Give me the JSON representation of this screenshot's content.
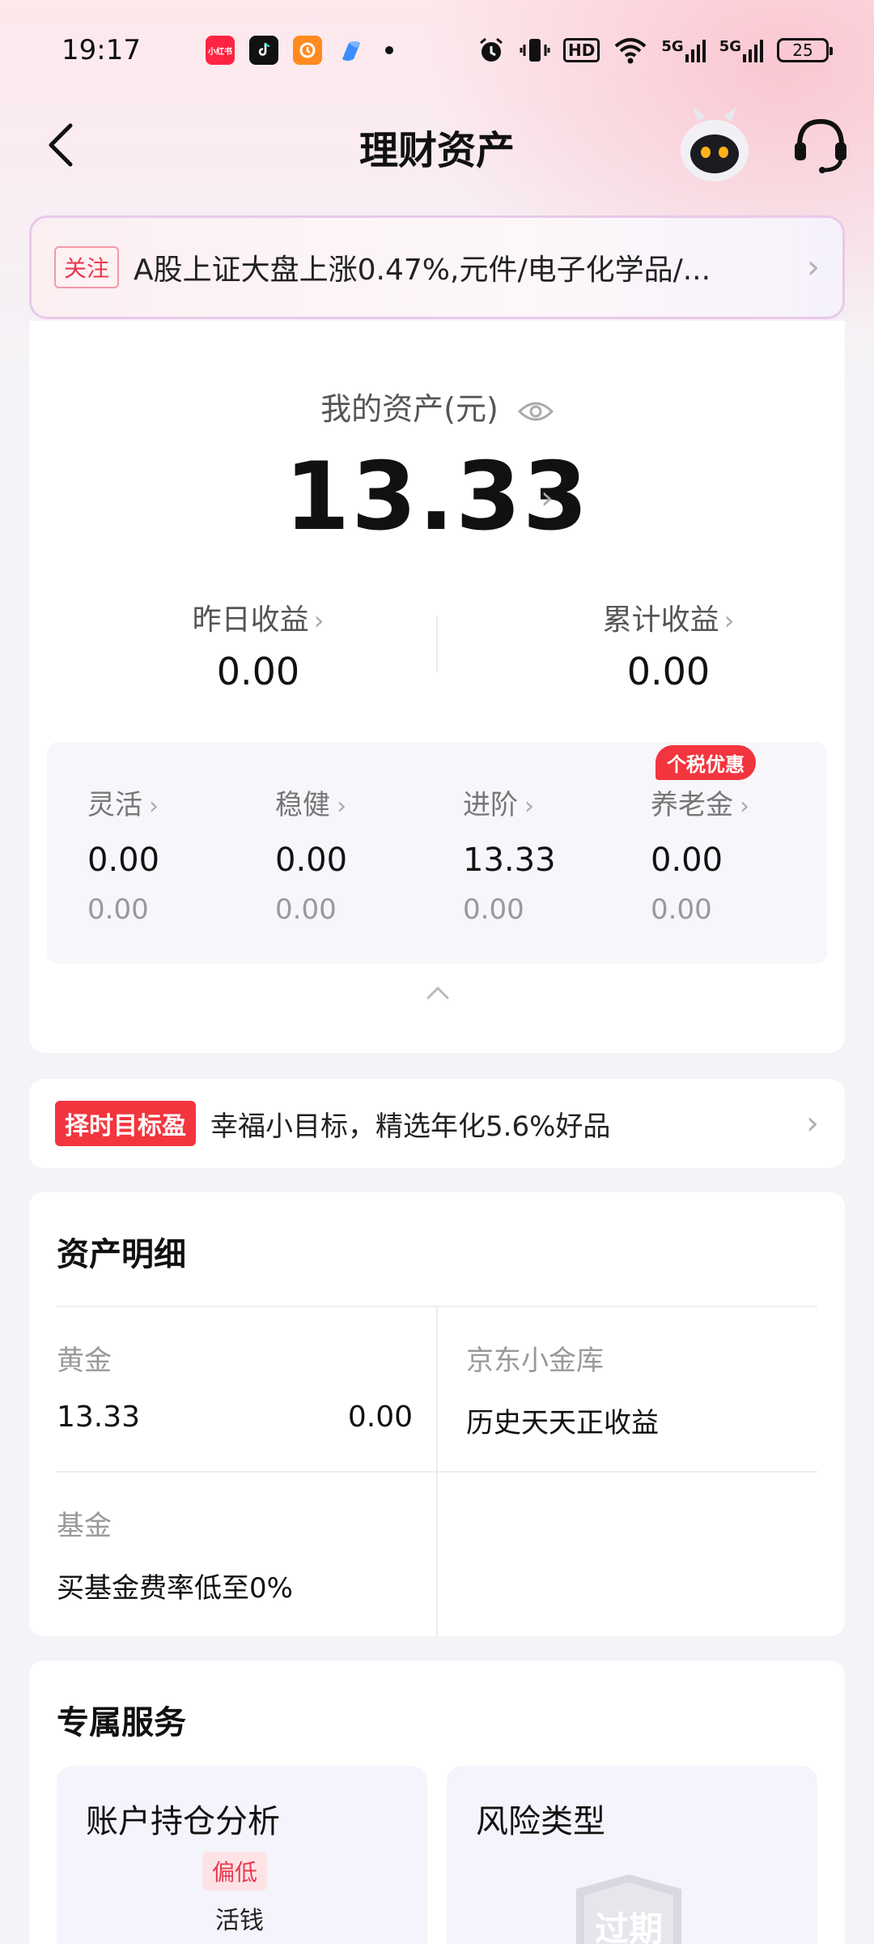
{
  "status_bar": {
    "time": "19:17",
    "app_icons": [
      "小红书",
      "抖音",
      "美团",
      "浏览器"
    ],
    "network_labels": [
      "HD",
      "5G",
      "5G"
    ],
    "battery": "25"
  },
  "nav": {
    "title": "理财资产"
  },
  "notice": {
    "tag": "关注",
    "text": "A股上证大盘上涨0.47%,元件/电子化学品/..."
  },
  "asset": {
    "label": "我的资产(元)",
    "value": "13.33",
    "yesterday_label": "昨日收益",
    "yesterday_value": "0.00",
    "total_label": "累计收益",
    "total_value": "0.00",
    "categories": [
      {
        "label": "灵活",
        "v1": "0.00",
        "v2": "0.00"
      },
      {
        "label": "稳健",
        "v1": "0.00",
        "v2": "0.00"
      },
      {
        "label": "进阶",
        "v1": "13.33",
        "v2": "0.00"
      },
      {
        "label": "养老金",
        "v1": "0.00",
        "v2": "0.00"
      }
    ],
    "tax_badge": "个税优惠"
  },
  "promo": {
    "tag": "择时目标盈",
    "text": "幸福小目标，精选年化5.6%好品"
  },
  "detail": {
    "title": "资产明细",
    "gold_label": "黄金",
    "gold_value": "13.33",
    "gold_value2": "0.00",
    "jd_label": "京东小金库",
    "jd_text": "历史天天正收益",
    "fund_label": "基金",
    "fund_text": "买基金费率低至0%"
  },
  "services": {
    "title": "专属服务",
    "analysis_title": "账户持仓分析",
    "low_tag": "偏低",
    "cash_label": "活钱",
    "risk_title": "风险类型",
    "risk_stamp": "过期"
  },
  "colors": {
    "accent_red": "#f2353e",
    "notice_border": "#e9c9ea"
  }
}
